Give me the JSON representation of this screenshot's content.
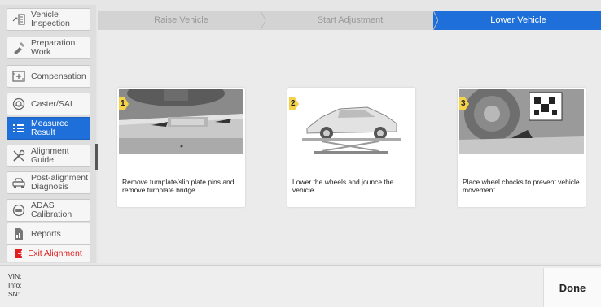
{
  "sidebar": {
    "items": [
      {
        "label": "Vehicle Inspection",
        "icon": "inspection-icon"
      },
      {
        "label": "Preparation Work",
        "icon": "tools-icon"
      },
      {
        "label": "Compensation",
        "icon": "compensation-icon"
      },
      {
        "label": "Caster/SAI",
        "icon": "wheel-icon"
      },
      {
        "label": "Measured Result",
        "icon": "list-icon",
        "active": true
      },
      {
        "label": "Alignment Guide",
        "icon": "wrench-icon"
      },
      {
        "label": "Post-alignment Diagnosis",
        "icon": "car-icon"
      },
      {
        "label": "ADAS Calibration",
        "icon": "adas-icon"
      },
      {
        "label": "Reports",
        "icon": "report-icon"
      }
    ],
    "exit_label": "Exit Alignment"
  },
  "steps": [
    "Raise Vehicle",
    "Start Adjustment",
    "Lower Vehicle"
  ],
  "cards": [
    {
      "number": "1",
      "caption": "Remove turnplate/slip plate pins and remove turnplate bridge."
    },
    {
      "number": "2",
      "caption": "Lower the wheels and jounce the vehicle."
    },
    {
      "number": "3",
      "caption": "Place wheel chocks to prevent vehicle movement."
    }
  ],
  "footer": {
    "vin": "VIN:",
    "info": "Info:",
    "sn": "SN:",
    "done_label": "Done"
  },
  "colors": {
    "accent": "#1e6fd9",
    "exit": "#e02020",
    "badge": "#f5d24a"
  }
}
